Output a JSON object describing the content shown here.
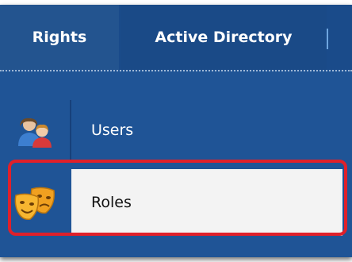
{
  "tabs": [
    {
      "label": "Rights",
      "active": true
    },
    {
      "label": "Active Directory",
      "active": false
    }
  ],
  "menu": {
    "items": [
      {
        "label": "Users",
        "icon": "users-icon",
        "selected": false
      },
      {
        "label": "Roles",
        "icon": "theater-masks-icon",
        "selected": true
      }
    ]
  },
  "colors": {
    "panel": "#1f5496",
    "tab_active": "#23548f",
    "selected_row": "#f3f3f3",
    "highlight": "#e0202a"
  }
}
